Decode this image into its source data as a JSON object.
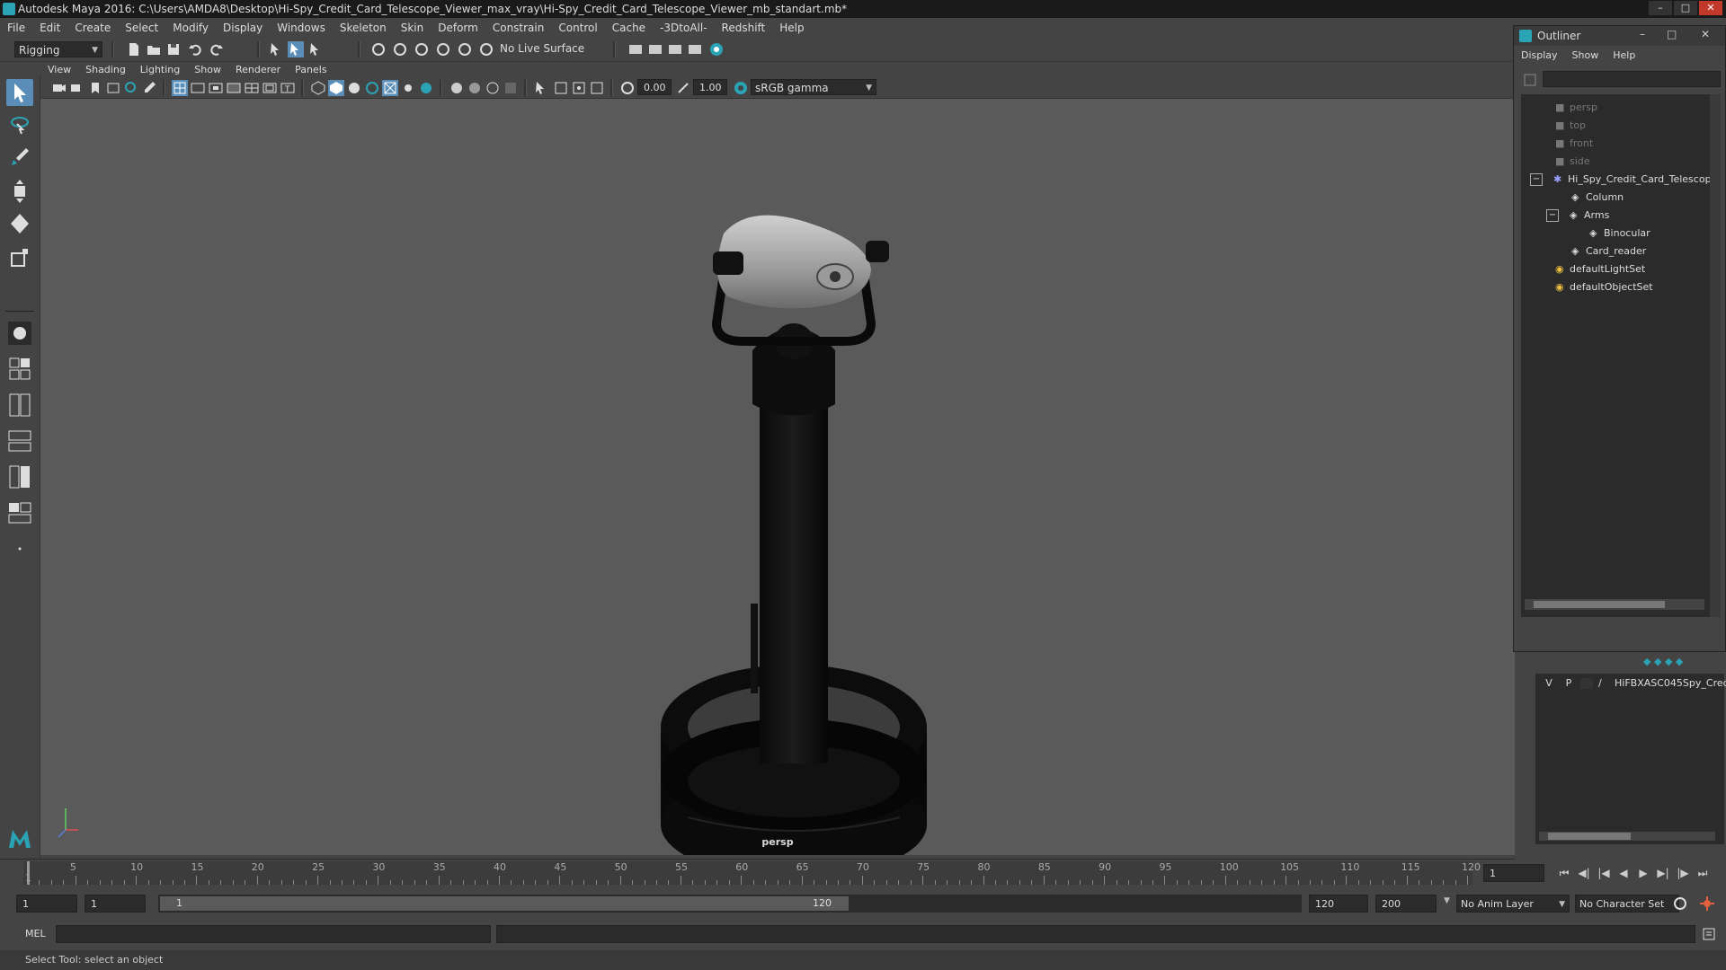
{
  "window": {
    "title": "Autodesk Maya 2016: C:\\Users\\AMDA8\\Desktop\\Hi-Spy_Credit_Card_Telescope_Viewer_max_vray\\Hi-Spy_Credit_Card_Telescope_Viewer_mb_standart.mb*"
  },
  "menubar": [
    "File",
    "Edit",
    "Create",
    "Select",
    "Modify",
    "Display",
    "Windows",
    "Skeleton",
    "Skin",
    "Deform",
    "Constrain",
    "Control",
    "Cache",
    "-3DtoAll-",
    "Redshift",
    "Help"
  ],
  "shelf": {
    "mode": "Rigging",
    "live_surface": "No Live Surface"
  },
  "viewport_menu": [
    "View",
    "Shading",
    "Lighting",
    "Show",
    "Renderer",
    "Panels"
  ],
  "viewport_toolbar": {
    "exposure": "0.00",
    "gamma": "1.00",
    "color_space": "sRGB gamma"
  },
  "viewport": {
    "camera": "persp"
  },
  "outliner": {
    "title": "Outliner",
    "menu": [
      "Display",
      "Show",
      "Help"
    ],
    "items": [
      {
        "label": "persp",
        "icon": "camera-icon",
        "dim": true
      },
      {
        "label": "top",
        "icon": "camera-icon",
        "dim": true
      },
      {
        "label": "front",
        "icon": "camera-icon",
        "dim": true
      },
      {
        "label": "side",
        "icon": "camera-icon",
        "dim": true
      },
      {
        "label": "Hi_Spy_Credit_Card_Telescop",
        "icon": "group-icon",
        "dim": false
      },
      {
        "label": "Column",
        "icon": "mesh-icon",
        "dim": false
      },
      {
        "label": "Arms",
        "icon": "mesh-icon",
        "dim": false
      },
      {
        "label": "Binocular",
        "icon": "mesh-icon",
        "dim": false
      },
      {
        "label": "Card_reader",
        "icon": "mesh-icon",
        "dim": false
      },
      {
        "label": "defaultLightSet",
        "icon": "set-icon",
        "dim": false
      },
      {
        "label": "defaultObjectSet",
        "icon": "set-icon",
        "dim": false
      }
    ]
  },
  "layers": {
    "visible_flag": "V",
    "playback_flag": "P",
    "layer_name": "HiFBXASC045Spy_Cred"
  },
  "timeline": {
    "ticks": [
      5,
      10,
      15,
      20,
      25,
      30,
      35,
      40,
      45,
      50,
      55,
      60,
      65,
      70,
      75,
      80,
      85,
      90,
      95,
      100,
      105,
      110,
      115,
      120
    ],
    "start_tick": "1",
    "current_frame": "1"
  },
  "range": {
    "start": "1",
    "playback_start": "1",
    "slider_start": "1",
    "slider_end": "120",
    "playback_end": "120",
    "end": "200",
    "anim_layer": "No Anim Layer",
    "character_set": "No Character Set"
  },
  "command": {
    "mode": "MEL"
  },
  "help_line": "Select Tool: select an object"
}
